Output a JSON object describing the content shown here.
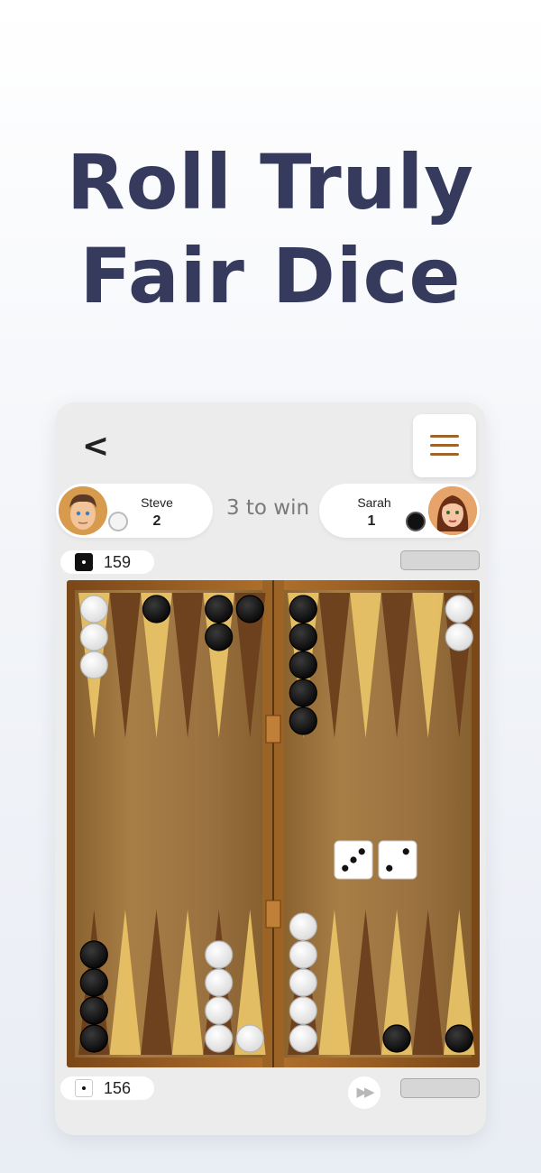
{
  "headline": {
    "line1": "Roll Truly",
    "line2": "Fair Dice"
  },
  "nav": {
    "back_label": "<",
    "menu_icon": "hamburger-menu-icon"
  },
  "match": {
    "target_label": "3 to win"
  },
  "players": {
    "left": {
      "name": "Steve",
      "score": "2",
      "checker": "white"
    },
    "right": {
      "name": "Sarah",
      "score": "1",
      "checker": "black"
    }
  },
  "pip_counts": {
    "top": "159",
    "bottom": "156"
  },
  "dice": [
    3,
    2
  ],
  "board": {
    "top_white_stacks": [
      3,
      0,
      0,
      0,
      0,
      0,
      0,
      0,
      0,
      0,
      0,
      2
    ],
    "top_black_stacks": [
      0,
      0,
      1,
      0,
      2,
      1,
      5,
      0,
      0,
      0,
      0,
      0
    ],
    "bottom_white_stacks": [
      0,
      0,
      0,
      0,
      4,
      1,
      5,
      0,
      0,
      0,
      0,
      0
    ],
    "bottom_black_stacks": [
      4,
      0,
      0,
      0,
      0,
      0,
      0,
      0,
      0,
      1,
      0,
      1
    ]
  },
  "colors": {
    "headline": "#363b5e",
    "menu": "#a0632a",
    "wood_light": "#e8c266",
    "wood_dark": "#6b3f1c"
  }
}
